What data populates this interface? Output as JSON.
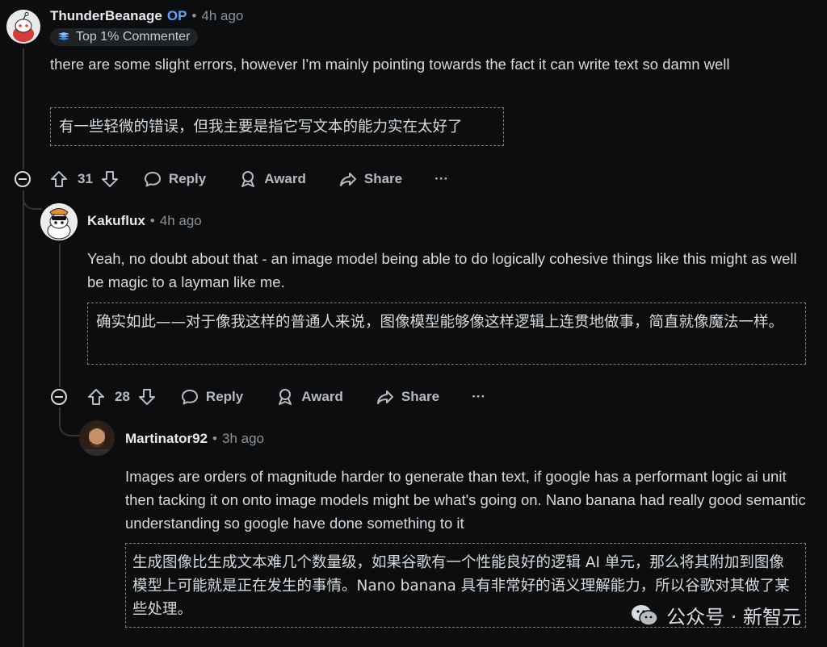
{
  "comments": [
    {
      "username": "ThunderBeanage",
      "op_badge": "OP",
      "time": "4h ago",
      "flair": "Top 1% Commenter",
      "text": "there are some slight errors, however I'm mainly pointing towards the fact it can write text so damn well",
      "translation": "有一些轻微的错误，但我主要是指它写文本的能力实在太好了",
      "votes": "31",
      "reply_label": "Reply",
      "award_label": "Award",
      "share_label": "Share",
      "more_label": "···"
    },
    {
      "username": "Kakuflux",
      "time": "4h ago",
      "text": "Yeah, no doubt about that - an image model being able to do logically cohesive things like this might as well be magic to a layman like me.",
      "translation": "确实如此——对于像我这样的普通人来说，图像模型能够像这样逻辑上连贯地做事，简直就像魔法一样。",
      "votes": "28",
      "reply_label": "Reply",
      "award_label": "Award",
      "share_label": "Share",
      "more_label": "···"
    },
    {
      "username": "Martinator92",
      "time": "3h ago",
      "text": "Images are orders of magnitude harder to generate than text, if google has a performant logic ai unit then tacking it on onto image models might be what's going on. Nano banana had really good semantic understanding so google have done something to it",
      "translation": "生成图像比生成文本难几个数量级，如果谷歌有一个性能良好的逻辑 AI 单元，那么将其附加到图像模型上可能就是正在发生的事情。Nano banana 具有非常好的语义理解能力，所以谷歌对其做了某些处理。"
    }
  ],
  "separator": "•",
  "watermark": "公众号 · 新智元",
  "colors": {
    "background": "#0b0d0f",
    "op": "#5fa3ff",
    "text": "#d7dadc",
    "muted": "#8d9296"
  }
}
